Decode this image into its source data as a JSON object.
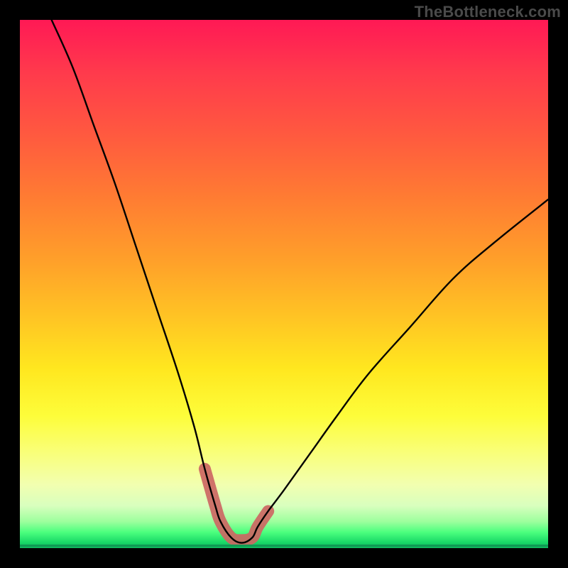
{
  "watermark": "TheBottleneck.com",
  "colors": {
    "page_bg": "#000000",
    "watermark_text": "#4a4a4a",
    "curve_stroke": "#000000",
    "highlight_stroke": "#cc6763",
    "gradient_top": "#ff1955",
    "gradient_mid": "#ffe71f",
    "gradient_bottom": "#17d766"
  },
  "chart_data": {
    "type": "line",
    "title": "",
    "xlabel": "",
    "ylabel": "",
    "xlim": [
      0,
      100
    ],
    "ylim": [
      0,
      100
    ],
    "grid": false,
    "legend": false,
    "description": "Bottleneck-style V curve. Y is a mismatch percentage (100 = worst, 0 = perfect balance). The curve descends steeply from the left, reaches ~0 near x≈38–45, and rises more gently toward the right. A short salmon highlight marks the near-optimal flat region at the bottom.",
    "series": [
      {
        "name": "bottleneck_curve",
        "x": [
          6,
          10,
          14,
          18,
          22,
          26,
          30,
          33,
          35,
          37,
          38,
          40,
          42,
          44,
          45,
          47,
          50,
          55,
          60,
          66,
          74,
          82,
          90,
          100
        ],
        "y": [
          100,
          91,
          80,
          69,
          57,
          45,
          33,
          23,
          15,
          8,
          5,
          2,
          1,
          2,
          4,
          7,
          11,
          18,
          25,
          33,
          42,
          51,
          58,
          66
        ]
      }
    ],
    "highlight_range": {
      "x_start": 35,
      "x_end": 47
    }
  }
}
